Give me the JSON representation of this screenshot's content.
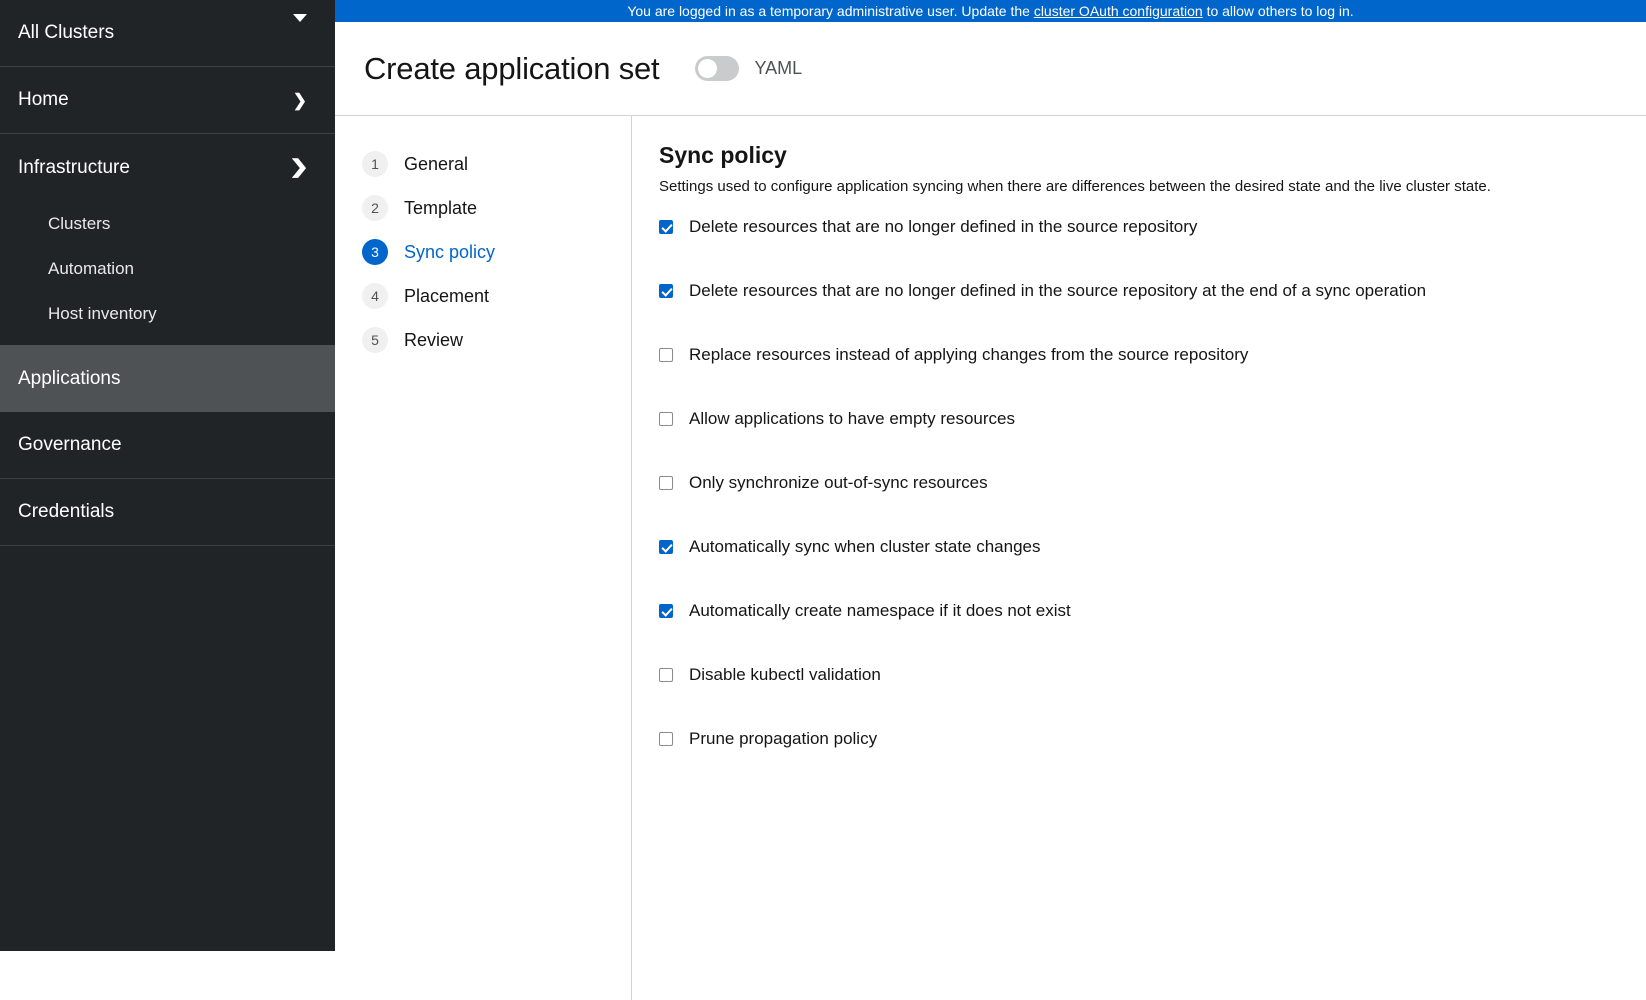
{
  "banner": {
    "text_before": "You are logged in as a temporary administrative user. Update the ",
    "link_text": "cluster OAuth configuration",
    "text_after": " to allow others to log in.",
    "background": "#0066cc"
  },
  "sidebar": {
    "cluster_selector": {
      "label": "All Clusters",
      "icon": "caret-down-icon"
    },
    "items": [
      {
        "label": "Home",
        "icon": "chevron-right-icon",
        "state": "collapsed",
        "level": "top"
      },
      {
        "label": "Infrastructure",
        "icon": "chevron-down-icon",
        "state": "expanded",
        "level": "top"
      },
      {
        "label": "Clusters",
        "level": "sub"
      },
      {
        "label": "Automation",
        "level": "sub"
      },
      {
        "label": "Host inventory",
        "level": "sub"
      },
      {
        "label": "Applications",
        "level": "top",
        "state": "active"
      },
      {
        "label": "Governance",
        "level": "top"
      },
      {
        "label": "Credentials",
        "level": "top"
      }
    ],
    "background": "#212427",
    "active_background": "#4f5255"
  },
  "header": {
    "title": "Create application set",
    "yaml_toggle": {
      "label": "YAML",
      "checked": false
    }
  },
  "wizard": {
    "steps": [
      {
        "number": "1",
        "label": "General",
        "current": false
      },
      {
        "number": "2",
        "label": "Template",
        "current": false
      },
      {
        "number": "3",
        "label": "Sync policy",
        "current": true
      },
      {
        "number": "4",
        "label": "Placement",
        "current": false
      },
      {
        "number": "5",
        "label": "Review",
        "current": false
      }
    ],
    "accent_color": "#0066cc"
  },
  "sync_policy": {
    "title": "Sync policy",
    "description": "Settings used to configure application syncing when there are differences between the desired state and the live cluster state.",
    "options": [
      {
        "label": "Delete resources that are no longer defined in the source repository",
        "checked": true
      },
      {
        "label": "Delete resources that are no longer defined in the source repository at the end of a sync operation",
        "checked": true
      },
      {
        "label": "Replace resources instead of applying changes from the source repository",
        "checked": false
      },
      {
        "label": "Allow applications to have empty resources",
        "checked": false
      },
      {
        "label": "Only synchronize out-of-sync resources",
        "checked": false
      },
      {
        "label": "Automatically sync when cluster state changes",
        "checked": true
      },
      {
        "label": "Automatically create namespace if it does not exist",
        "checked": true
      },
      {
        "label": "Disable kubectl validation",
        "checked": false
      },
      {
        "label": "Prune propagation policy",
        "checked": false
      }
    ]
  }
}
